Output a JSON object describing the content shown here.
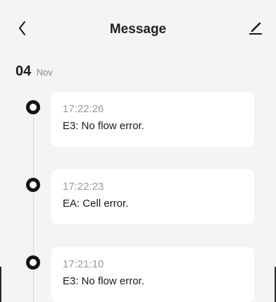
{
  "header": {
    "title": "Message",
    "back_icon": "chevron-left-icon",
    "edit_icon": "edit-pen-icon"
  },
  "date_group": {
    "day": "04",
    "month": "Nov"
  },
  "messages": [
    {
      "time": "17:22:26",
      "text": "E3: No flow error."
    },
    {
      "time": "17:22:23",
      "text": "EA: Cell error."
    },
    {
      "time": "17:21:10",
      "text": "E3: No flow error."
    }
  ],
  "colors": {
    "background": "#f4f4f4",
    "card": "#ffffff",
    "dot": "#141414",
    "time_text": "#9a9a9a"
  }
}
